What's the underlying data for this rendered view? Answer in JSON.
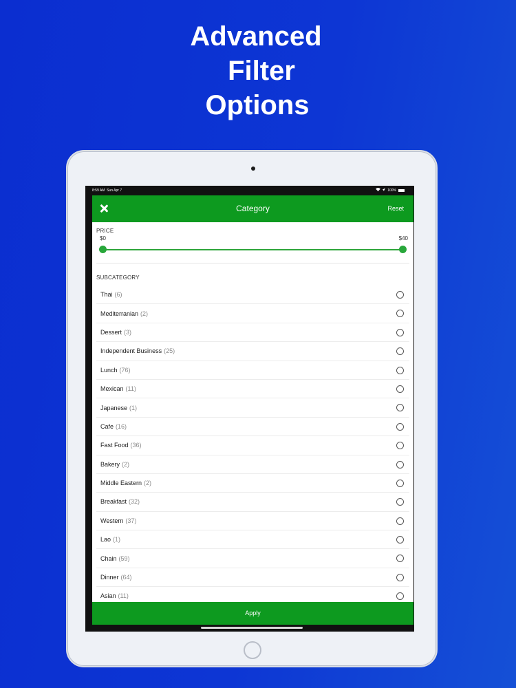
{
  "headline": {
    "line1": "Advanced",
    "line2": "Filter",
    "line3": "Options"
  },
  "statusbar": {
    "time": "8:59 AM",
    "date": "Sun Apr 7",
    "battery": "100%"
  },
  "navbar": {
    "title": "Category",
    "reset_label": "Reset"
  },
  "price": {
    "label": "PRICE",
    "min_label": "$0",
    "max_label": "$40",
    "min_value": 0,
    "max_value": 40
  },
  "subcategory": {
    "label": "SUBCATEGORY",
    "items": [
      {
        "name": "Thai",
        "count": "(6)"
      },
      {
        "name": "Mediterranian",
        "count": "(2)"
      },
      {
        "name": "Dessert",
        "count": "(3)"
      },
      {
        "name": "Independent Business",
        "count": "(25)"
      },
      {
        "name": "Lunch",
        "count": "(76)"
      },
      {
        "name": "Mexican",
        "count": "(11)"
      },
      {
        "name": "Japanese",
        "count": "(1)"
      },
      {
        "name": "Cafe",
        "count": "(16)"
      },
      {
        "name": "Fast Food",
        "count": "(36)"
      },
      {
        "name": "Bakery",
        "count": "(2)"
      },
      {
        "name": "Middle Eastern",
        "count": "(2)"
      },
      {
        "name": "Breakfast",
        "count": "(32)"
      },
      {
        "name": "Western",
        "count": "(37)"
      },
      {
        "name": "Lao",
        "count": "(1)"
      },
      {
        "name": "Chain",
        "count": "(59)"
      },
      {
        "name": "Dinner",
        "count": "(64)"
      },
      {
        "name": "Asian",
        "count": "(11)"
      }
    ]
  },
  "apply_label": "Apply",
  "colors": {
    "accent": "#0d9a1f",
    "background": "#0b2ed0"
  },
  "icons": {
    "close": "close-icon",
    "wifi": "wifi-icon",
    "battery": "battery-icon"
  }
}
